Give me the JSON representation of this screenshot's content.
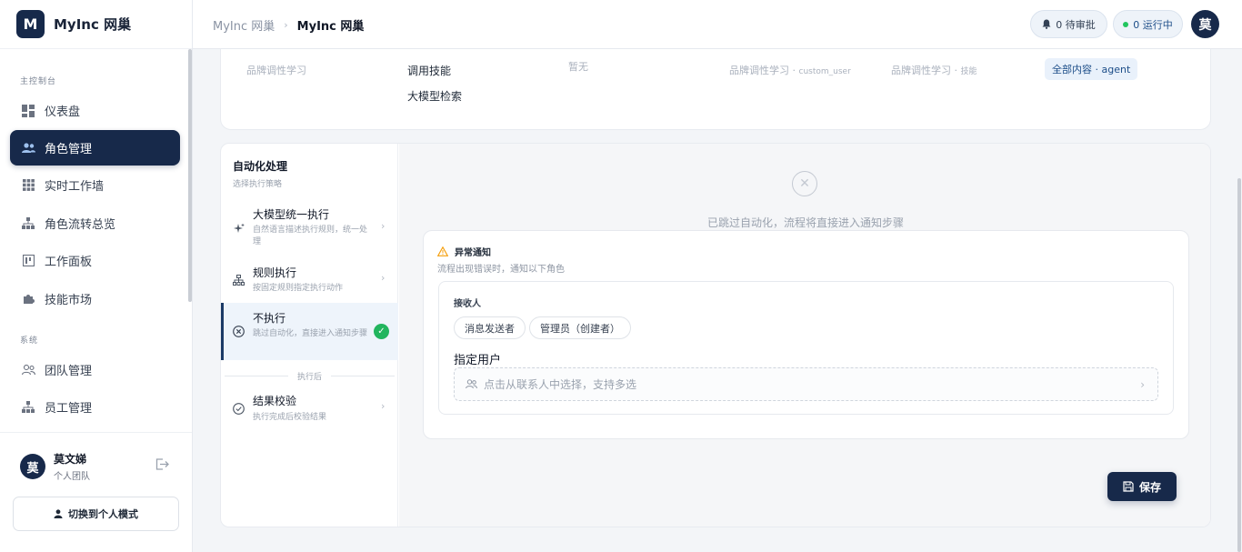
{
  "app": {
    "logo_letter": "M",
    "name": "MyInc 网巢"
  },
  "sidebar": {
    "section_main": "主控制台",
    "section_system": "系统",
    "items": [
      {
        "label": "仪表盘",
        "icon": "dashboard-icon"
      },
      {
        "label": "角色管理",
        "icon": "users-icon",
        "active": true
      },
      {
        "label": "实时工作墙",
        "icon": "grid-icon"
      },
      {
        "label": "角色流转总览",
        "icon": "flow-icon"
      },
      {
        "label": "工作面板",
        "icon": "board-icon"
      },
      {
        "label": "技能市场",
        "icon": "puzzle-icon"
      },
      {
        "label": "团队管理",
        "icon": "team-icon"
      },
      {
        "label": "员工管理",
        "icon": "org-icon"
      }
    ],
    "user": {
      "avatar": "莫",
      "name": "莫文娣",
      "team": "个人团队"
    },
    "switch_label": "切换到个人模式"
  },
  "header": {
    "breadcrumb_root": "MyInc 网巢",
    "breadcrumb_current": "MyInc 网巢",
    "pending": "0 待审批",
    "running": "0 运行中",
    "avatar": "莫"
  },
  "top_card": {
    "c1": "品牌调性学习",
    "c2a": "调用技能",
    "c2b": "大模型检索",
    "c3": "暂无",
    "c4": "品牌调性学习 · ",
    "c4_tag": "custom_user",
    "c5": "品牌调性学习 · ",
    "c5_tag": "技能",
    "badge": "全部内容 · agent"
  },
  "automation": {
    "title": "自动化处理",
    "subtitle": "选择执行策略",
    "strategies": [
      {
        "title": "大模型统一执行",
        "desc": "自然语言描述执行规则，统一处理"
      },
      {
        "title": "规则执行",
        "desc": "按固定规则指定执行动作"
      },
      {
        "title": "不执行",
        "desc": "跳过自动化，直接进入通知步骤"
      }
    ],
    "after_label": "执行后",
    "verify": {
      "title": "结果校验",
      "desc": "执行完成后校验结果"
    }
  },
  "detail": {
    "skip_text": "已跳过自动化，流程将直接进入通知步骤",
    "notice_title": "异常通知",
    "notice_sub": "流程出现错误时，通知以下角色",
    "receivers_title": "接收人",
    "chips": [
      "消息发送者",
      "管理员（创建者）"
    ],
    "assign_label": "指定用户",
    "picker_placeholder": "点击从联系人中选择，支持多选",
    "save_label": "保存"
  }
}
